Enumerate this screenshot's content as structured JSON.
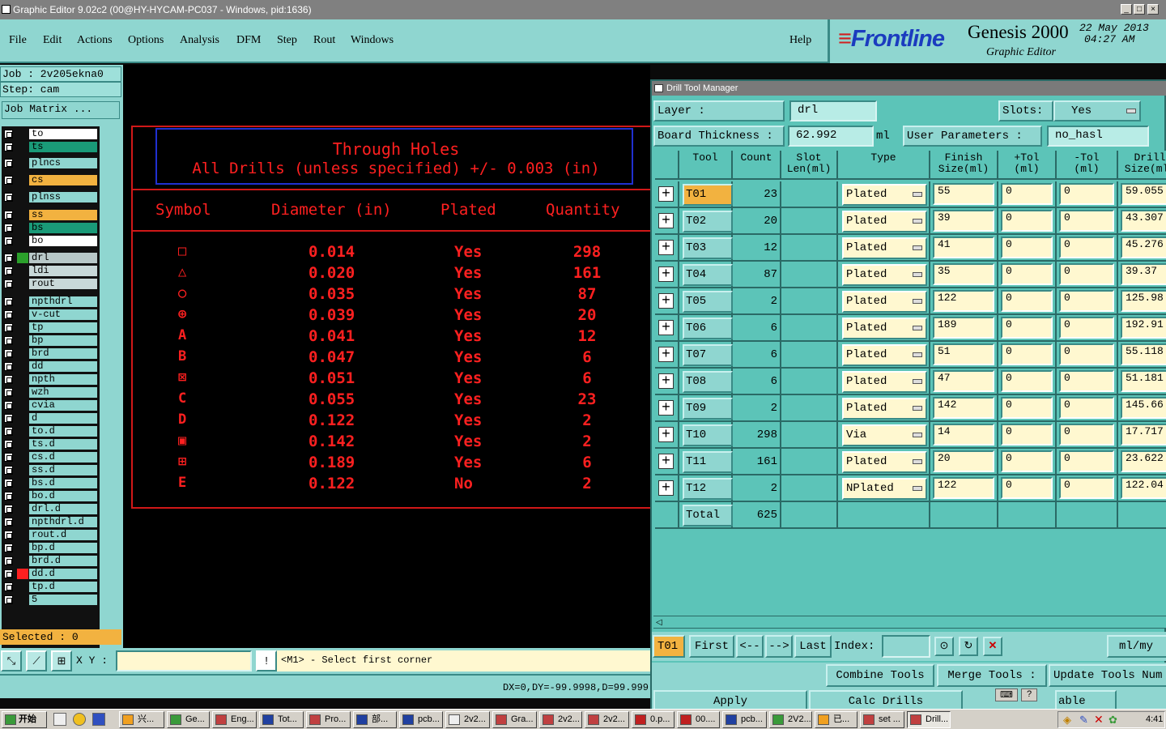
{
  "window": {
    "title": "Graphic Editor 9.02c2 (00@HY-HYCAM-PC037 - Windows, pid:1636)"
  },
  "menu": [
    "File",
    "Edit",
    "Actions",
    "Options",
    "Analysis",
    "DFM",
    "Step",
    "Rout",
    "Windows"
  ],
  "help_label": "Help",
  "brand": {
    "logo": "Frontline",
    "product": "Genesis 2000",
    "subtitle": "Graphic Editor",
    "date": "22 May 2013",
    "time": "04:27 AM"
  },
  "left": {
    "job": "Job : 2v205ekna0",
    "step": "Step: cam",
    "job_matrix": "Job Matrix ...",
    "selected": "Selected : 0",
    "layers": [
      {
        "name": "to",
        "color": "#ffffff"
      },
      {
        "name": "ts",
        "color": "#1a9a78"
      },
      {
        "name": "plncs",
        "color": "#8fd6d0"
      },
      {
        "name": "cs",
        "color": "#f2b240"
      },
      {
        "name": "plnss",
        "color": "#8fd6d0"
      },
      {
        "name": "ss",
        "color": "#f2b240"
      },
      {
        "name": "bs",
        "color": "#1a9a78"
      },
      {
        "name": "bo",
        "color": "#ffffff"
      },
      {
        "name": "drl",
        "color": "#b8c8c8"
      },
      {
        "name": "ldi",
        "color": "#c8d8d8"
      },
      {
        "name": "rout",
        "color": "#c8d8d8"
      },
      {
        "name": "npthdrl",
        "color": "#8fd6d0"
      },
      {
        "name": "v-cut",
        "color": "#8fd6d0"
      },
      {
        "name": "tp",
        "color": "#8fd6d0"
      },
      {
        "name": "bp",
        "color": "#8fd6d0"
      },
      {
        "name": "brd",
        "color": "#8fd6d0"
      },
      {
        "name": "dd",
        "color": "#8fd6d0"
      },
      {
        "name": "npth",
        "color": "#8fd6d0"
      },
      {
        "name": "wzh",
        "color": "#8fd6d0"
      },
      {
        "name": "cvia",
        "color": "#8fd6d0"
      },
      {
        "name": "d",
        "color": "#8fd6d0"
      },
      {
        "name": "to.d",
        "color": "#8fd6d0"
      },
      {
        "name": "ts.d",
        "color": "#8fd6d0"
      },
      {
        "name": "cs.d",
        "color": "#8fd6d0"
      },
      {
        "name": "ss.d",
        "color": "#8fd6d0"
      },
      {
        "name": "bs.d",
        "color": "#8fd6d0"
      },
      {
        "name": "bo.d",
        "color": "#8fd6d0"
      },
      {
        "name": "drl.d",
        "color": "#8fd6d0"
      },
      {
        "name": "npthdrl.d",
        "color": "#8fd6d0"
      },
      {
        "name": "rout.d",
        "color": "#8fd6d0"
      },
      {
        "name": "bp.d",
        "color": "#8fd6d0"
      },
      {
        "name": "brd.d",
        "color": "#8fd6d0"
      },
      {
        "name": "dd.d",
        "color": "#8fd6d0"
      },
      {
        "name": "tp.d",
        "color": "#8fd6d0"
      },
      {
        "name": "5",
        "color": "#8fd6d0"
      }
    ]
  },
  "canvas": {
    "title1": "Through Holes",
    "title2": "All Drills (unless specified) +/- 0.003 (in)",
    "headers": [
      "Symbol",
      "Diameter (in)",
      "Plated",
      "Quantity"
    ],
    "rows": [
      {
        "sym": "□",
        "dia": "0.014",
        "plated": "Yes",
        "qty": "298"
      },
      {
        "sym": "△",
        "dia": "0.020",
        "plated": "Yes",
        "qty": "161"
      },
      {
        "sym": "○",
        "dia": "0.035",
        "plated": "Yes",
        "qty": "87"
      },
      {
        "sym": "⊕",
        "dia": "0.039",
        "plated": "Yes",
        "qty": "20"
      },
      {
        "sym": "A",
        "dia": "0.041",
        "plated": "Yes",
        "qty": "12"
      },
      {
        "sym": "B",
        "dia": "0.047",
        "plated": "Yes",
        "qty": "6"
      },
      {
        "sym": "⊠",
        "dia": "0.051",
        "plated": "Yes",
        "qty": "6"
      },
      {
        "sym": "C",
        "dia": "0.055",
        "plated": "Yes",
        "qty": "23"
      },
      {
        "sym": "D",
        "dia": "0.122",
        "plated": "Yes",
        "qty": "2"
      },
      {
        "sym": "▣",
        "dia": "0.142",
        "plated": "Yes",
        "qty": "2"
      },
      {
        "sym": "⊞",
        "dia": "0.189",
        "plated": "Yes",
        "qty": "6"
      },
      {
        "sym": "E",
        "dia": "0.122",
        "plated": "No",
        "qty": "2"
      }
    ]
  },
  "bottom": {
    "xy_label": "X Y :",
    "prompt": "<M1> - Select first corner",
    "coords": "DX=0,DY=-99.9998,D=99.999"
  },
  "dtm": {
    "title": "Drill Tool Manager",
    "layer_label": "Layer          :",
    "layer_value": "drl",
    "slots_label": "Slots:",
    "slots_value": "Yes",
    "thickness_label": "Board Thickness :",
    "thickness_value": "62.992",
    "thickness_unit": "ml",
    "user_params_label": "User Parameters :",
    "user_params_value": "no_hasl",
    "columns": [
      "Tool",
      "Count",
      "Slot\nLen(ml)",
      "Type",
      "Finish\nSize(ml)",
      "+Tol\n(ml)",
      "-Tol\n(ml)",
      "Drill\nSize(ml)"
    ],
    "rows": [
      {
        "tool": "T01",
        "count": "23",
        "type": "Plated",
        "finish": "55",
        "ptol": "0",
        "mtol": "0",
        "drill": "59.055"
      },
      {
        "tool": "T02",
        "count": "20",
        "type": "Plated",
        "finish": "39",
        "ptol": "0",
        "mtol": "0",
        "drill": "43.307"
      },
      {
        "tool": "T03",
        "count": "12",
        "type": "Plated",
        "finish": "41",
        "ptol": "0",
        "mtol": "0",
        "drill": "45.276"
      },
      {
        "tool": "T04",
        "count": "87",
        "type": "Plated",
        "finish": "35",
        "ptol": "0",
        "mtol": "0",
        "drill": "39.37"
      },
      {
        "tool": "T05",
        "count": "2",
        "type": "Plated",
        "finish": "122",
        "ptol": "0",
        "mtol": "0",
        "drill": "125.98"
      },
      {
        "tool": "T06",
        "count": "6",
        "type": "Plated",
        "finish": "189",
        "ptol": "0",
        "mtol": "0",
        "drill": "192.91"
      },
      {
        "tool": "T07",
        "count": "6",
        "type": "Plated",
        "finish": "51",
        "ptol": "0",
        "mtol": "0",
        "drill": "55.118"
      },
      {
        "tool": "T08",
        "count": "6",
        "type": "Plated",
        "finish": "47",
        "ptol": "0",
        "mtol": "0",
        "drill": "51.181"
      },
      {
        "tool": "T09",
        "count": "2",
        "type": "Plated",
        "finish": "142",
        "ptol": "0",
        "mtol": "0",
        "drill": "145.66"
      },
      {
        "tool": "T10",
        "count": "298",
        "type": "Via",
        "finish": "14",
        "ptol": "0",
        "mtol": "0",
        "drill": "17.717"
      },
      {
        "tool": "T11",
        "count": "161",
        "type": "Plated",
        "finish": "20",
        "ptol": "0",
        "mtol": "0",
        "drill": "23.622"
      },
      {
        "tool": "T12",
        "count": "2",
        "type": "NPlated",
        "finish": "122",
        "ptol": "0",
        "mtol": "0",
        "drill": "122.04"
      }
    ],
    "total_label": "Total",
    "total_count": "625",
    "nav": {
      "current": "T01",
      "first": "First",
      "prev": "<--",
      "next": "-->",
      "last": "Last",
      "index": "Index:",
      "units": "ml/my"
    },
    "actions": {
      "combine": "Combine Tools",
      "merge": "Merge Tools :",
      "update": "Update Tools Num",
      "apply": "Apply",
      "calc": "Calc Drills",
      "table": "able"
    }
  },
  "taskbar": {
    "start": "开始",
    "clock": "4:41",
    "tasks": [
      "兴...",
      "Ge...",
      "Eng...",
      "Tot...",
      "Pro...",
      "部...",
      "pcb...",
      "2v2...",
      "Gra...",
      "2v2...",
      "2v2...",
      "0.p...",
      "00....",
      "pcb...",
      "2V2...",
      "已...",
      "set ...",
      "Drill..."
    ]
  }
}
